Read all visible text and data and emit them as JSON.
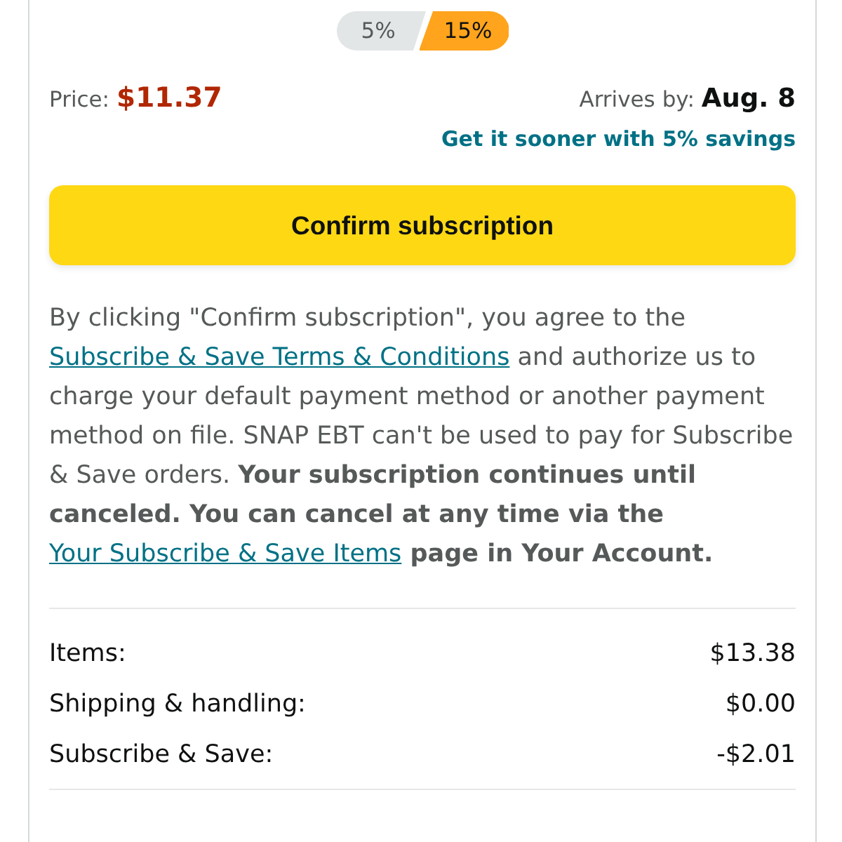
{
  "discount_options": [
    {
      "label": "5%",
      "selected": false
    },
    {
      "label": "15%",
      "selected": true
    }
  ],
  "price": {
    "label": "Price:",
    "value": "$11.37"
  },
  "delivery": {
    "label": "Arrives by:",
    "date": "Aug. 8"
  },
  "sooner_link": "Get it sooner with 5% savings",
  "confirm_button": "Confirm subscription",
  "disclaimer": [
    {
      "kind": "text",
      "text": "By clicking \"Confirm subscription\", you agree to the "
    },
    {
      "kind": "link",
      "text": "Subscribe & Save Terms & Conditions"
    },
    {
      "kind": "text",
      "text": " and authorize us to charge your default payment method or another payment method on file. SNAP EBT can't be used to pay for Subscribe & Save orders. "
    },
    {
      "kind": "bold",
      "text": "Your subscription continues until canceled. You can cancel at any time via the "
    },
    {
      "kind": "link",
      "text": "Your Subscribe & Save Items"
    },
    {
      "kind": "bold",
      "text": " page in Your Account."
    }
  ],
  "summary": [
    {
      "label": "Items:",
      "value": "$13.38"
    },
    {
      "label": "Shipping & handling:",
      "value": "$0.00"
    },
    {
      "label": "Subscribe & Save:",
      "value": "-$2.01"
    }
  ]
}
